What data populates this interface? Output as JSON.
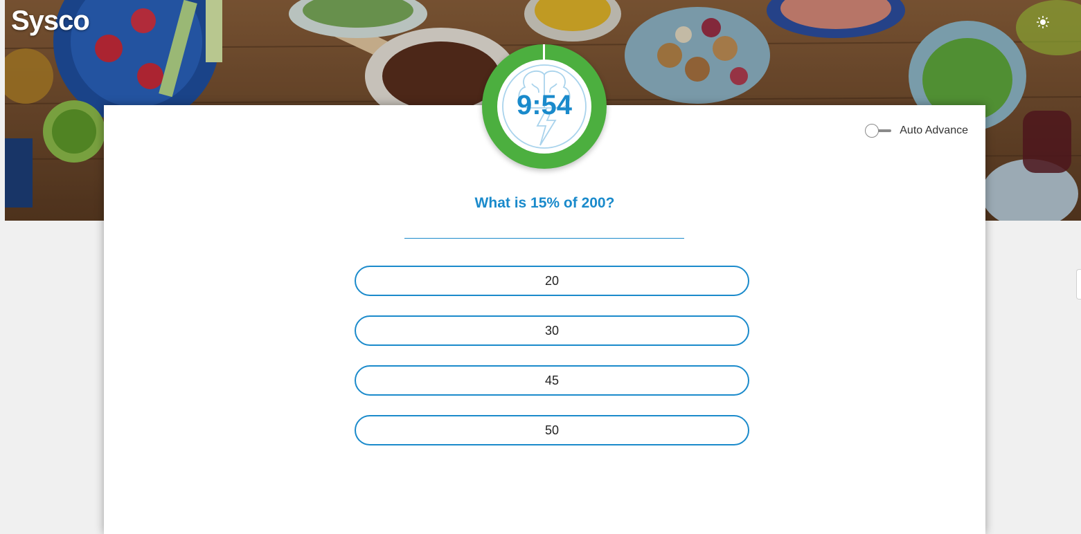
{
  "header": {
    "logo": "Sysco",
    "brightness_icon": "brightness-icon"
  },
  "timer": {
    "time": "9:54",
    "ring_color": "#4caf3f",
    "icon": "brain-lightning-icon"
  },
  "auto_advance": {
    "label": "Auto Advance",
    "enabled": false
  },
  "question": {
    "text": "What is 15% of 200?"
  },
  "answers": [
    {
      "label": "20"
    },
    {
      "label": "30"
    },
    {
      "label": "45"
    },
    {
      "label": "50"
    }
  ],
  "colors": {
    "accent": "#1a8acb",
    "timer_green": "#4caf3f",
    "background": "#f0f0f0"
  }
}
